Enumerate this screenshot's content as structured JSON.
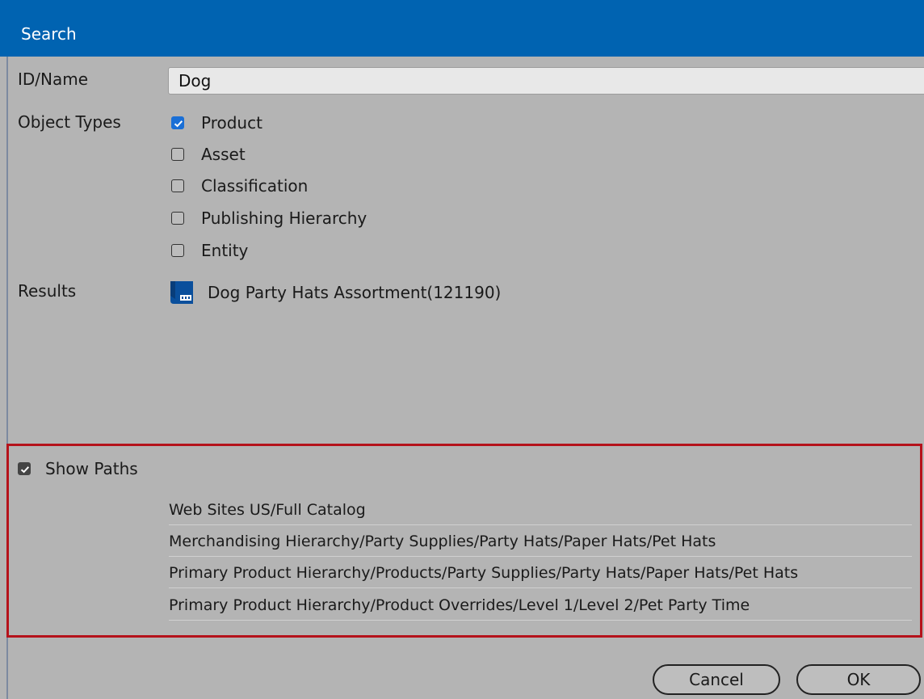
{
  "dialog": {
    "title": "Search"
  },
  "search": {
    "id_name_label": "ID/Name",
    "id_name_value": "Dog"
  },
  "object_types": {
    "label": "Object Types",
    "items": [
      {
        "label": "Product",
        "checked": true
      },
      {
        "label": "Asset",
        "checked": false
      },
      {
        "label": "Classification",
        "checked": false
      },
      {
        "label": "Publishing Hierarchy",
        "checked": false
      },
      {
        "label": "Entity",
        "checked": false
      }
    ]
  },
  "results": {
    "label": "Results",
    "items": [
      {
        "icon": "product-icon",
        "label": "Dog Party Hats Assortment(121190)"
      }
    ]
  },
  "show_paths": {
    "label": "Show Paths",
    "checked": true,
    "paths": [
      "Web Sites US/Full Catalog",
      "Merchandising Hierarchy/Party Supplies/Party Hats/Paper Hats/Pet Hats",
      "Primary Product Hierarchy/Products/Party Supplies/Party Hats/Paper Hats/Pet Hats",
      "Primary Product Hierarchy/Product Overrides/Level 1/Level 2/Pet Party Time"
    ]
  },
  "buttons": {
    "cancel": "Cancel",
    "ok": "OK"
  },
  "colors": {
    "title_bar": "#0063b1",
    "checkbox_checked": "#1a6fd6",
    "highlight_border": "#b5121b"
  }
}
